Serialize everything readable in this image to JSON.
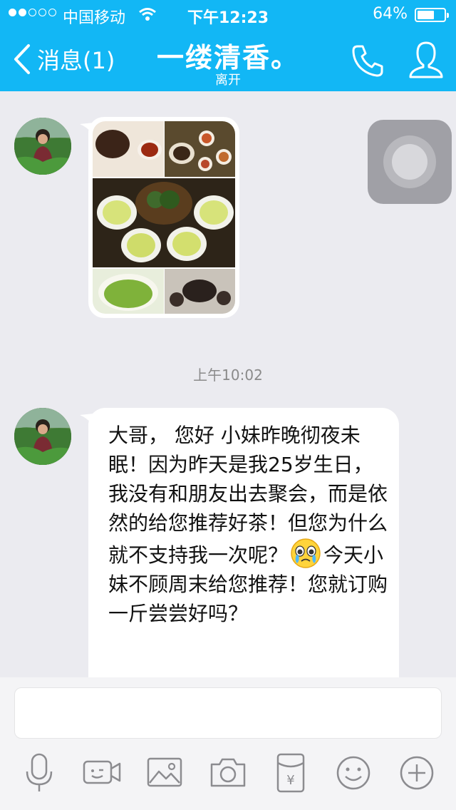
{
  "status_bar": {
    "carrier": "中国移动",
    "time": "下午12:23",
    "battery_percent_text": "64%",
    "battery_level": 0.64,
    "signal_bars_filled": 2,
    "signal_bars_total": 5
  },
  "nav": {
    "back_label": "消息(1)",
    "title": "一缕清香。",
    "subtitle": "离开"
  },
  "chat": {
    "timestamp": "上午10:02",
    "message_parts": [
      "大哥， 您好 小妹昨晚彻夜未眠！因为昨天是我25岁生日，我没有和朋友出去聚会，而是依然的给您推荐好茶！但您为什么就不支持我一次呢？",
      "今天小妹不顾周末给您推荐！您就订购一斤尝尝好吗？"
    ],
    "emoji_name": "crying-face-emoji"
  },
  "input": {
    "placeholder": ""
  },
  "toolbar_icons": [
    "microphone-icon",
    "video-icon",
    "image-icon",
    "camera-icon",
    "red-packet-icon",
    "emoji-icon",
    "plus-icon"
  ],
  "colors": {
    "header_blue": "#12b7f5",
    "chat_background": "#ebebf0",
    "icon_gray": "#8c8c90"
  }
}
